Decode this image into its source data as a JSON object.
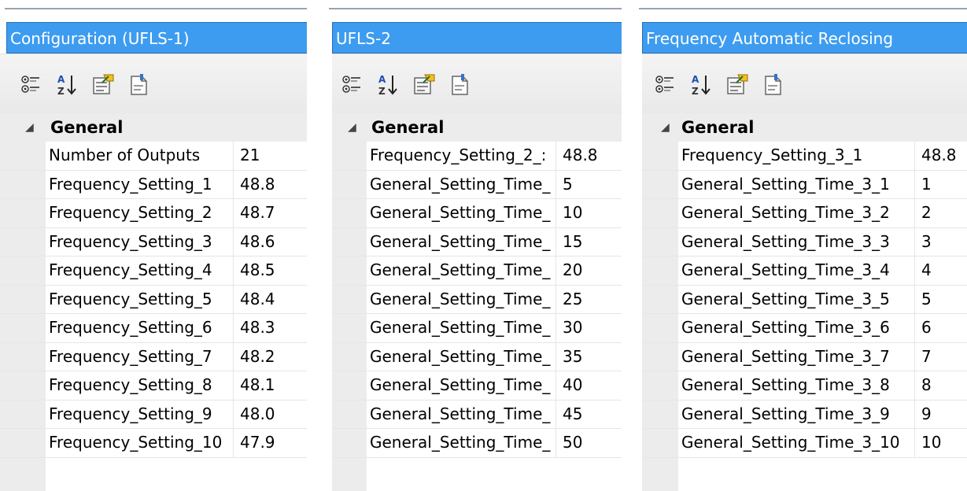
{
  "panels": [
    {
      "title": "Configuration (UFLS-1)",
      "category": "General",
      "properties": [
        {
          "name": "Number of Outputs",
          "value": "21"
        },
        {
          "name": "Frequency_Setting_1",
          "value": "48.8"
        },
        {
          "name": "Frequency_Setting_2",
          "value": "48.7"
        },
        {
          "name": "Frequency_Setting_3",
          "value": "48.6"
        },
        {
          "name": "Frequency_Setting_4",
          "value": "48.5"
        },
        {
          "name": "Frequency_Setting_5",
          "value": "48.4"
        },
        {
          "name": "Frequency_Setting_6",
          "value": "48.3"
        },
        {
          "name": "Frequency_Setting_7",
          "value": "48.2"
        },
        {
          "name": "Frequency_Setting_8",
          "value": "48.1"
        },
        {
          "name": "Frequency_Setting_9",
          "value": "48.0"
        },
        {
          "name": "Frequency_Setting_10",
          "value": "47.9"
        }
      ]
    },
    {
      "title": "UFLS-2",
      "category": "General",
      "properties": [
        {
          "name": "Frequency_Setting_2_:",
          "value": "48.8"
        },
        {
          "name": "General_Setting_Time_",
          "value": "5"
        },
        {
          "name": "General_Setting_Time_",
          "value": "10"
        },
        {
          "name": "General_Setting_Time_",
          "value": "15"
        },
        {
          "name": "General_Setting_Time_",
          "value": "20"
        },
        {
          "name": "General_Setting_Time_",
          "value": "25"
        },
        {
          "name": "General_Setting_Time_",
          "value": "30"
        },
        {
          "name": "General_Setting_Time_",
          "value": "35"
        },
        {
          "name": "General_Setting_Time_",
          "value": "40"
        },
        {
          "name": "General_Setting_Time_",
          "value": "45"
        },
        {
          "name": "General_Setting_Time_",
          "value": "50"
        }
      ]
    },
    {
      "title": "Frequency Automatic Reclosing",
      "category": "General",
      "properties": [
        {
          "name": "Frequency_Setting_3_1",
          "value": "48.8"
        },
        {
          "name": "General_Setting_Time_3_1",
          "value": "1"
        },
        {
          "name": "General_Setting_Time_3_2",
          "value": "2"
        },
        {
          "name": "General_Setting_Time_3_3",
          "value": "3"
        },
        {
          "name": "General_Setting_Time_3_4",
          "value": "4"
        },
        {
          "name": "General_Setting_Time_3_5",
          "value": "5"
        },
        {
          "name": "General_Setting_Time_3_6",
          "value": "6"
        },
        {
          "name": "General_Setting_Time_3_7",
          "value": "7"
        },
        {
          "name": "General_Setting_Time_3_8",
          "value": "8"
        },
        {
          "name": "General_Setting_Time_3_9",
          "value": "9"
        },
        {
          "name": "General_Setting_Time_3_10",
          "value": "10"
        }
      ]
    }
  ],
  "toolbar_icons": [
    "categorized-icon",
    "alphabetical-sort-icon",
    "property-pages-icon",
    "events-icon"
  ]
}
